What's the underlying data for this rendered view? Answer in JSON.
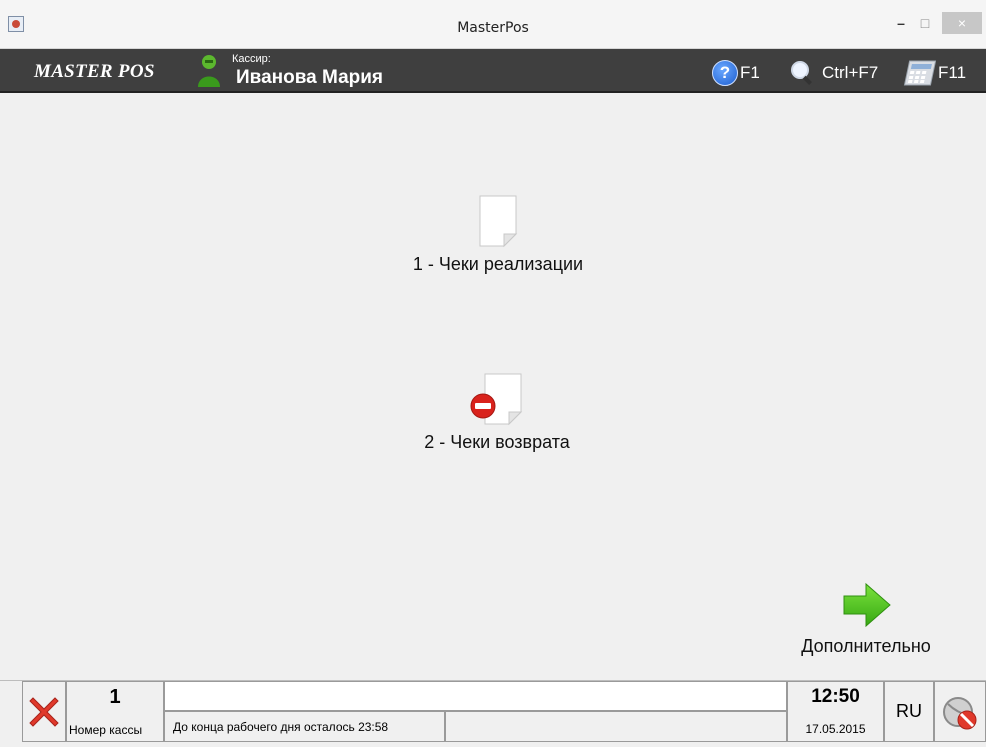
{
  "window": {
    "title": "MasterPos",
    "min": "–",
    "max": "□",
    "close": "×"
  },
  "header": {
    "brand": "MASTER POS",
    "cashier_caption": "Кассир:",
    "cashier_name": "Иванова Мария",
    "hotkeys": [
      {
        "icon": "help-icon",
        "label": "F1"
      },
      {
        "icon": "search-icon",
        "label": "Ctrl+F7"
      },
      {
        "icon": "calculator-icon",
        "label": "F11"
      }
    ],
    "help_glyph": "?"
  },
  "menu": {
    "sales": {
      "label": "1 - Чеки реализации",
      "icon": "document-icon"
    },
    "returns": {
      "label": "2 - Чеки возврата",
      "icon": "document-minus-icon"
    },
    "more": {
      "label": "Дополнительно",
      "icon": "arrow-right-icon"
    }
  },
  "status": {
    "register_number": "1",
    "register_label": "Номер кассы",
    "message_top": "",
    "workday_left": "До конца рабочего дня осталось 23:58",
    "message_right": "",
    "time": "12:50",
    "date": "17.05.2015",
    "language": "RU"
  },
  "colors": {
    "header_bg": "#3f3f3f",
    "close_red": "#e0392b",
    "arrow_green": "#4cc21a"
  }
}
